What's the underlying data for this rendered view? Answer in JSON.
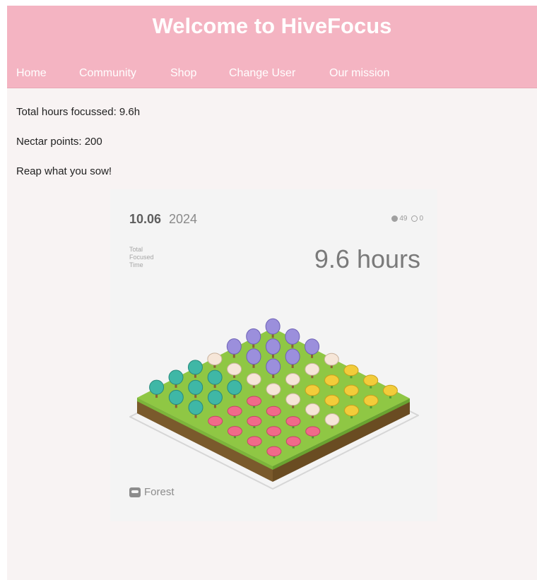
{
  "header": {
    "title": "Welcome to HiveFocus",
    "nav": [
      {
        "label": "Home"
      },
      {
        "label": "Community"
      },
      {
        "label": "Shop"
      },
      {
        "label": "Change User"
      },
      {
        "label": "Our mission"
      }
    ]
  },
  "info": {
    "hours_focussed": "Total hours focussed: 9.6h",
    "nectar_points": "Nectar points: 200",
    "tagline": "Reap what you sow!"
  },
  "forest_card": {
    "date": "10.06",
    "year": "2024",
    "trees_count": "49",
    "dead_count": "0",
    "label_total": "Total",
    "label_focused": "Focused",
    "label_time": "Time",
    "hours": "9.6 hours",
    "brand": "Forest"
  },
  "colors": {
    "header": "#f4b4c2",
    "background": "#f8f3f3",
    "grass": "#8fc744",
    "dirt": "#7a5a2c"
  }
}
